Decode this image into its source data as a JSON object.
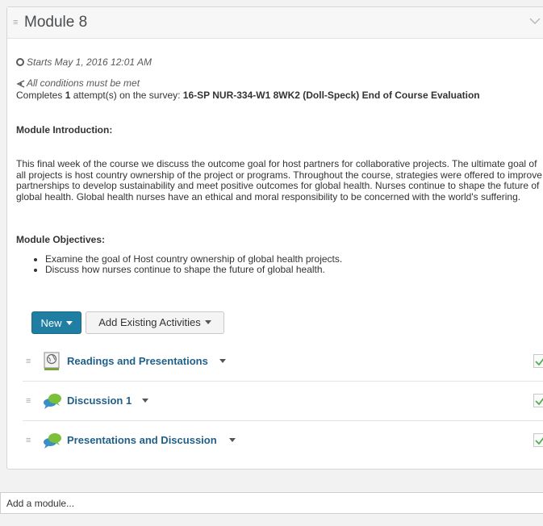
{
  "module": {
    "title": "Module 8",
    "starts": "Starts May 1, 2016 12:01 AM",
    "conditions": "All conditions must be met",
    "completes_prefix": "Completes ",
    "completes_count": "1",
    "completes_mid": " attempt(s) on the survey: ",
    "completes_survey": "16-SP NUR-334-W1 8WK2 (Doll-Speck) End of Course Evaluation",
    "intro_heading": "Module Introduction:",
    "intro_text": "This final week of the course we discuss the outcome goal for host partners for collaborative projects. The ultimate goal of all projects is host country ownership of the project or programs. Throughout the course, strategies were offered to improve partnerships to develop sustainability and meet positive outcomes for global health. Nurses continue to shape the future of global health. Global health nurses have an ethical and moral responsibility to be concerned with the world's suffering.",
    "objectives_heading": "Module Objectives:",
    "objectives": [
      "Examine the goal of Host country ownership of global health projects.",
      "Discuss how nurses continue to shape the future of global health."
    ]
  },
  "toolbar": {
    "new_label": "New",
    "add_existing_label": "Add Existing Activities"
  },
  "items": [
    {
      "title": "Readings and Presentations",
      "icon": "html-document-icon"
    },
    {
      "title": "Discussion 1",
      "icon": "discussion-icon"
    },
    {
      "title": "Presentations and Discussion",
      "icon": "discussion-icon"
    }
  ],
  "add_module": {
    "placeholder": "Add a module..."
  },
  "colors": {
    "accent": "#1f7ea1",
    "link": "#1f5f88",
    "check": "#4caf50"
  }
}
